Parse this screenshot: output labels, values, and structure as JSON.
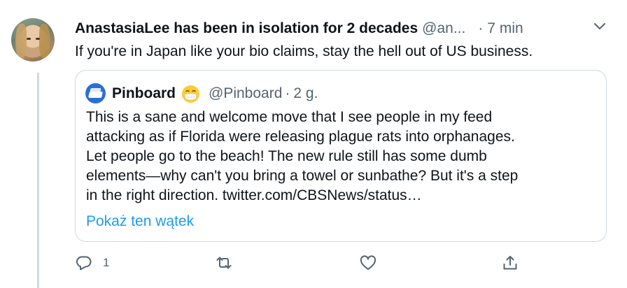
{
  "tweet": {
    "display_name": "AnastasiaLee has been in isolation for 2 decades",
    "handle": "@an...",
    "separator": "·",
    "time": "7 min",
    "text": "If you're in Japan like your bio claims, stay the hell out of US  business."
  },
  "quote": {
    "display_name": "Pinboard",
    "emoji": "mask-emoji-icon",
    "handle": "@Pinboard",
    "separator": "·",
    "time": "2 g.",
    "lines": [
      "This is a sane and welcome move that I see people in my feed",
      "attacking as if Florida were releasing plague rats into orphanages.",
      "Let people go to the beach! The new rule still has some dumb",
      "elements—why can't you bring a towel or sunbathe? But it's a step",
      "in the right direction. twitter.com/CBSNews/status…"
    ],
    "show_thread": "Pokaż ten wątek"
  },
  "actions": {
    "reply_count": "1",
    "retweet_count": "",
    "like_count": "",
    "icons": [
      "reply-icon",
      "retweet-icon",
      "like-icon",
      "share-icon"
    ]
  },
  "colors": {
    "link": "#1d9bf0",
    "secondary_text": "#536471",
    "border": "#cfd9de",
    "thread_line": "#cfd9de"
  }
}
